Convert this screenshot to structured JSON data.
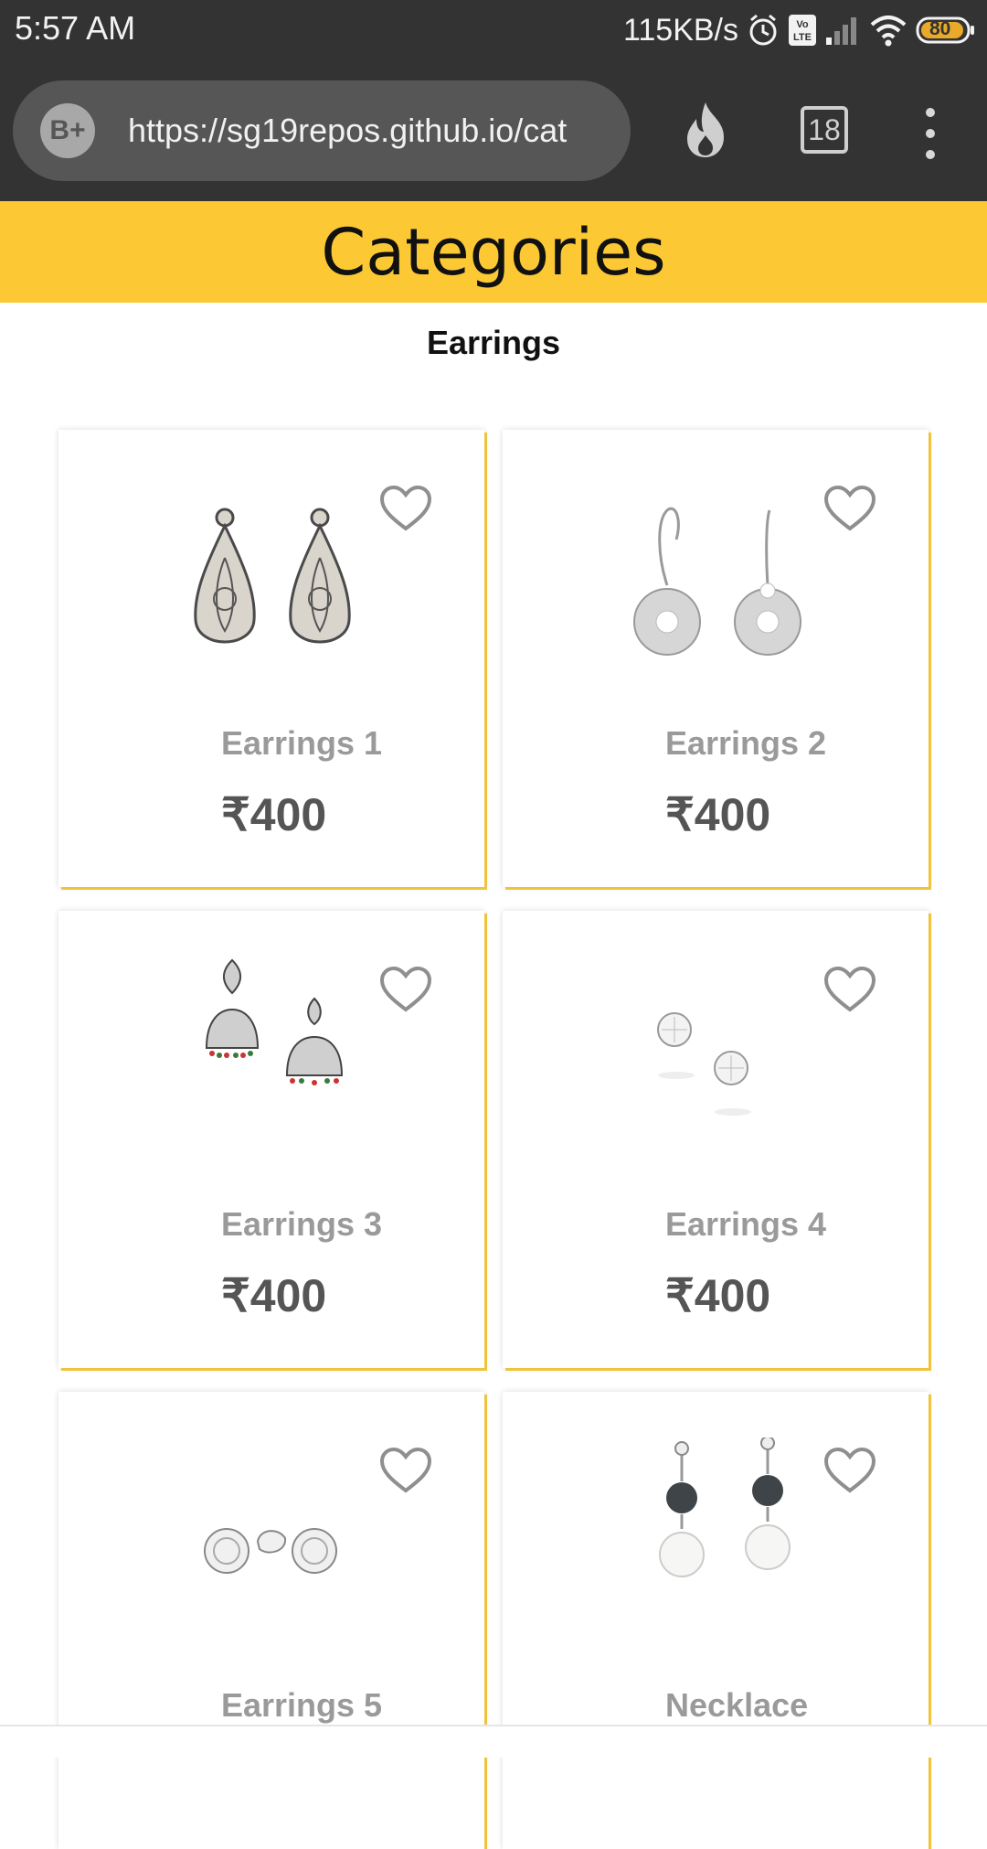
{
  "status": {
    "time": "5:57 AM",
    "net_speed": "115KB/s",
    "battery": "80"
  },
  "browser": {
    "site_badge": "B+",
    "url": "https://sg19repos.github.io/cat",
    "tab_count": "18"
  },
  "page": {
    "title": "Categories",
    "section": "Earrings"
  },
  "products": [
    {
      "name": "Earrings 1",
      "price": "₹400"
    },
    {
      "name": "Earrings 2",
      "price": "₹400"
    },
    {
      "name": "Earrings 3",
      "price": "₹400"
    },
    {
      "name": "Earrings 4",
      "price": "₹400"
    },
    {
      "name": "Earrings 5",
      "price": ""
    },
    {
      "name": "Necklace",
      "price": ""
    }
  ],
  "colors": {
    "header_yellow": "#fcc934",
    "toolbar_dark": "#333333"
  }
}
